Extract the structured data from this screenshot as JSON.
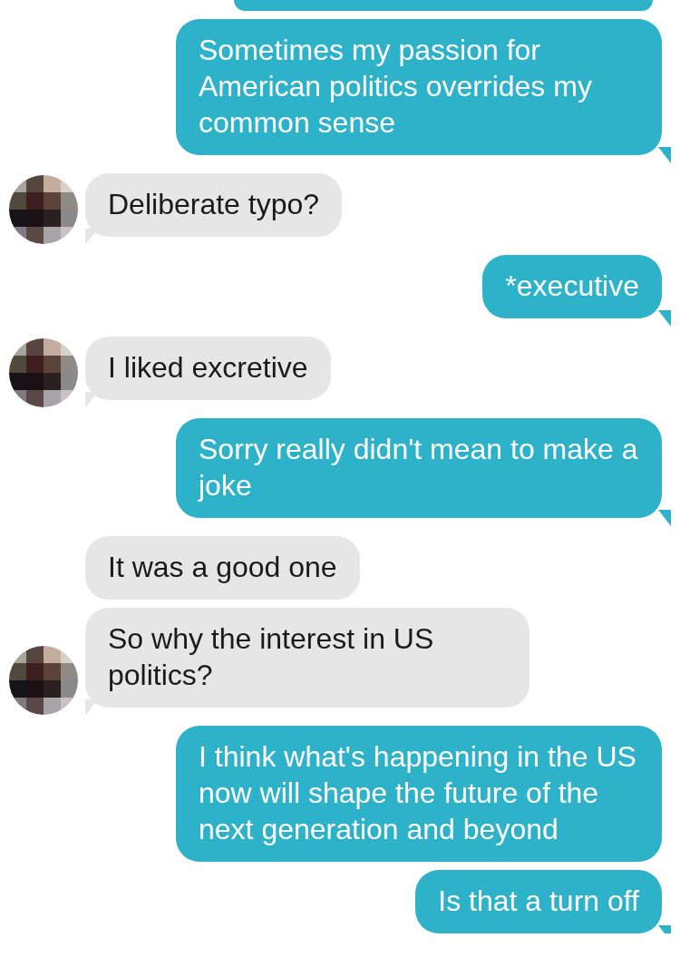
{
  "messages": [
    {
      "kind": "sent",
      "partial": true,
      "tail": false
    },
    {
      "kind": "sent",
      "text": "Sometimes my passion for American politics overrides my common sense",
      "tail": true
    },
    {
      "kind": "received",
      "text": "Deliberate typo?",
      "tail": true,
      "avatar": true
    },
    {
      "kind": "sent",
      "text": "*executive",
      "tail": true
    },
    {
      "kind": "received",
      "text": "I liked excretive",
      "tail": true,
      "avatar": true
    },
    {
      "kind": "sent",
      "text": "Sorry really didn't mean to make a joke",
      "tail": true
    },
    {
      "kind": "received",
      "text": "It was a good one",
      "tail": false,
      "avatar": false
    },
    {
      "kind": "received",
      "text": "So why the interest in US politics?",
      "tail": true,
      "avatar": true
    },
    {
      "kind": "sent",
      "text": "I think what's happening in the US now will shape the future of the next generation and beyond",
      "tail": false
    },
    {
      "kind": "sent",
      "text": "Is that a turn off",
      "tail": true
    }
  ]
}
